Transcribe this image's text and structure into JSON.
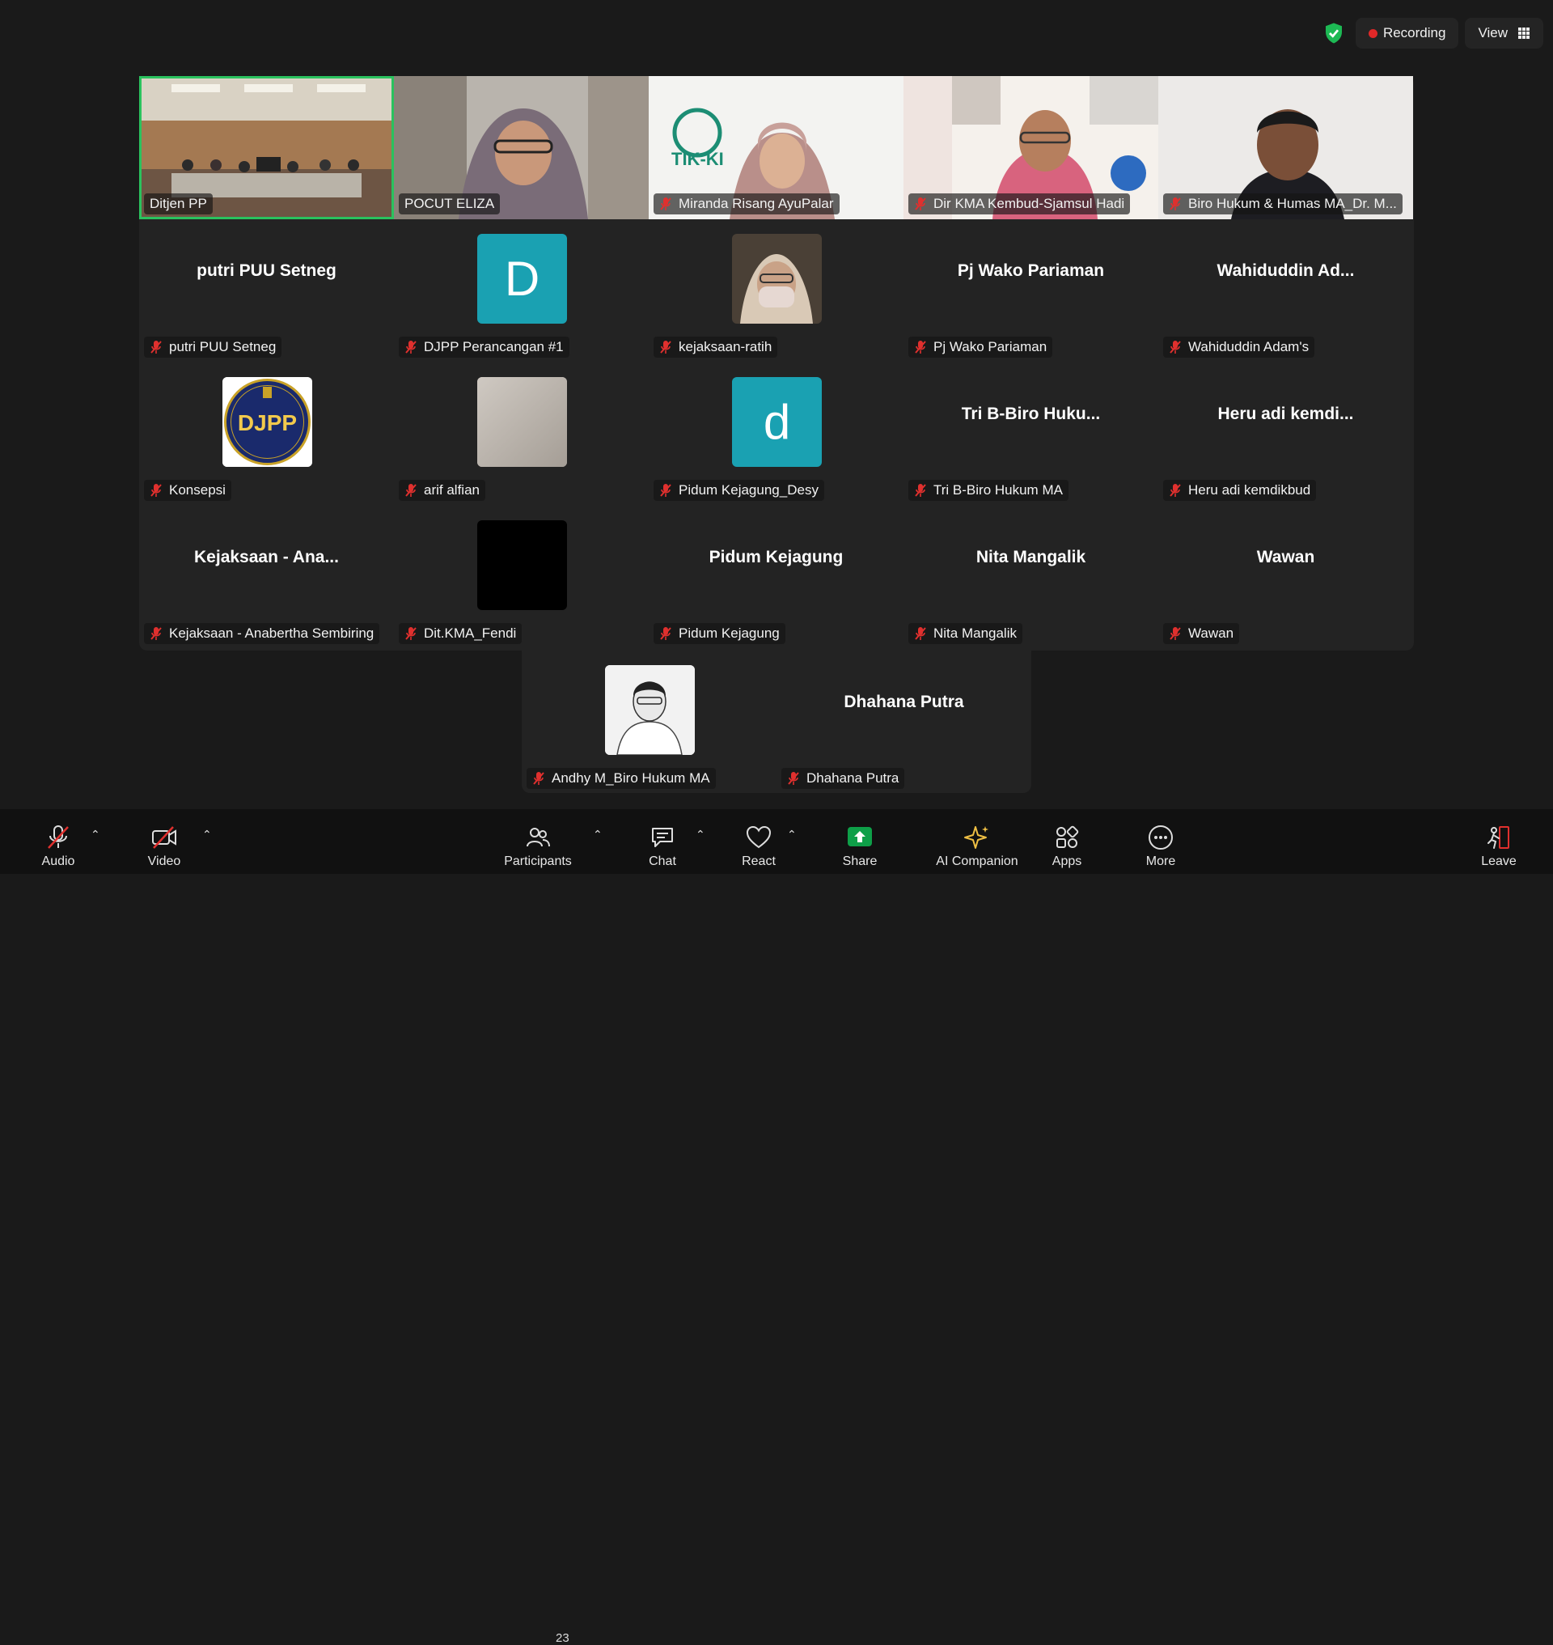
{
  "top": {
    "recording": "Recording",
    "view": "View"
  },
  "video_tiles": [
    {
      "name": "Ditjen PP",
      "muted": false,
      "active": true
    },
    {
      "name": "POCUT ELIZA",
      "muted": false
    },
    {
      "name": "Miranda Risang AyuPalar",
      "muted": true
    },
    {
      "name": "Dir KMA Kembud-Sjamsul Hadi",
      "muted": true
    },
    {
      "name": "Biro Hukum & Humas MA_Dr. M...",
      "muted": true
    }
  ],
  "tiles": [
    {
      "big": "putri PUU Setneg",
      "tag": "putri PUU Setneg"
    },
    {
      "avatar": "D",
      "tag": "DJPP Perancangan #1"
    },
    {
      "photo": "kejaksaan-ratih",
      "tag": "kejaksaan-ratih"
    },
    {
      "big": "Pj Wako Pariaman",
      "tag": "Pj Wako Pariaman"
    },
    {
      "big": "Wahiduddin  Ad...",
      "tag": "Wahiduddin Adam's"
    },
    {
      "logo": "DJPP",
      "tag": "Konsepsi"
    },
    {
      "photo": "arif alfian",
      "tag": "arif alfian"
    },
    {
      "avatar": "d",
      "tag": "Pidum Kejagung_Desy"
    },
    {
      "big": "Tri B-Biro Huku...",
      "tag": "Tri B-Biro Hukum MA"
    },
    {
      "big": "Heru  adi  kemdi...",
      "tag": "Heru adi kemdikbud"
    },
    {
      "big": "Kejaksaan  -  Ana...",
      "tag": "Kejaksaan - Anabertha Sembiring"
    },
    {
      "photo": "black",
      "tag": "Dit.KMA_Fendi"
    },
    {
      "big": "Pidum Kejagung",
      "tag": "Pidum Kejagung"
    },
    {
      "big": "Nita Mangalik",
      "tag": "Nita Mangalik"
    },
    {
      "big": "Wawan",
      "tag": "Wawan"
    }
  ],
  "bottom_tiles": [
    {
      "photo": "sketch",
      "tag": "Andhy M_Biro Hukum MA"
    },
    {
      "big": "Dhahana Putra",
      "tag": "Dhahana Putra"
    }
  ],
  "toolbar": {
    "audio": "Audio",
    "video": "Video",
    "participants": "Participants",
    "participants_count": "23",
    "chat": "Chat",
    "react": "React",
    "share": "Share",
    "ai": "AI Companion",
    "apps": "Apps",
    "more": "More",
    "leave": "Leave"
  },
  "colors": {
    "active_border": "#2ac25e",
    "avatar_bg": "#1aa1b2",
    "share_green": "#0e9f48",
    "muted_red": "#e0302e"
  }
}
